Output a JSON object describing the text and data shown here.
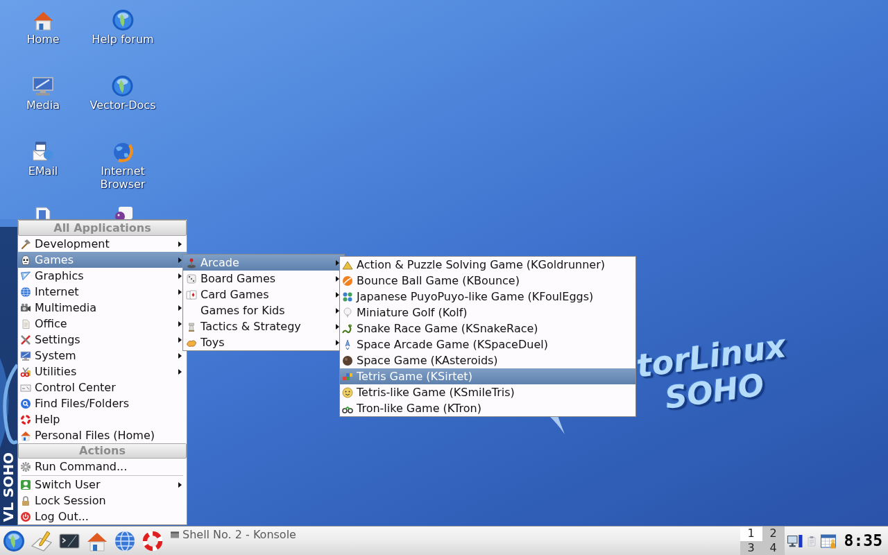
{
  "desktop": {
    "icons": [
      {
        "label": "Home"
      },
      {
        "label": "Help forum"
      },
      {
        "label": "Media"
      },
      {
        "label": "Vector-Docs"
      },
      {
        "label": "EMail"
      },
      {
        "label": "Internet Browser"
      }
    ],
    "wallpaper_logo": [
      "torLinux",
      "SOHO"
    ]
  },
  "start_menu": {
    "side_label": "VL SOHO",
    "sections": [
      {
        "title": "All Applications",
        "items": [
          {
            "label": "Development",
            "submenu": true,
            "selected": false
          },
          {
            "label": "Games",
            "submenu": true,
            "selected": true
          },
          {
            "label": "Graphics",
            "submenu": true,
            "selected": false
          },
          {
            "label": "Internet",
            "submenu": true,
            "selected": false
          },
          {
            "label": "Multimedia",
            "submenu": true,
            "selected": false
          },
          {
            "label": "Office",
            "submenu": true,
            "selected": false
          },
          {
            "label": "Settings",
            "submenu": true,
            "selected": false
          },
          {
            "label": "System",
            "submenu": true,
            "selected": false
          },
          {
            "label": "Utilities",
            "submenu": true,
            "selected": false
          },
          {
            "label": "Control Center",
            "submenu": false,
            "selected": false
          },
          {
            "label": "Find Files/Folders",
            "submenu": false,
            "selected": false
          },
          {
            "label": "Help",
            "submenu": false,
            "selected": false
          },
          {
            "label": "Personal Files (Home)",
            "submenu": false,
            "selected": false
          }
        ]
      },
      {
        "title": "Actions",
        "items": [
          {
            "label": "Run Command...",
            "submenu": false,
            "selected": false
          },
          {
            "label": "Switch User",
            "submenu": true,
            "selected": false,
            "separator_before": true
          },
          {
            "label": "Lock Session",
            "submenu": false,
            "selected": false
          },
          {
            "label": "Log Out...",
            "submenu": false,
            "selected": false
          }
        ]
      }
    ]
  },
  "games_menu": {
    "items": [
      {
        "label": "Arcade",
        "submenu": true,
        "selected": true
      },
      {
        "label": "Board Games",
        "submenu": true,
        "selected": false
      },
      {
        "label": "Card Games",
        "submenu": true,
        "selected": false
      },
      {
        "label": "Games for Kids",
        "submenu": true,
        "selected": false
      },
      {
        "label": "Tactics & Strategy",
        "submenu": true,
        "selected": false
      },
      {
        "label": "Toys",
        "submenu": true,
        "selected": false
      }
    ]
  },
  "arcade_menu": {
    "items": [
      {
        "label": "Action & Puzzle Solving Game (KGoldrunner)",
        "submenu": false,
        "selected": false
      },
      {
        "label": "Bounce Ball Game (KBounce)",
        "submenu": false,
        "selected": false
      },
      {
        "label": "Japanese PuyoPuyo-like Game (KFoulEggs)",
        "submenu": false,
        "selected": false
      },
      {
        "label": "Miniature Golf (Kolf)",
        "submenu": false,
        "selected": false
      },
      {
        "label": "Snake Race Game (KSnakeRace)",
        "submenu": false,
        "selected": false
      },
      {
        "label": "Space Arcade Game (KSpaceDuel)",
        "submenu": false,
        "selected": false
      },
      {
        "label": "Space Game (KAsteroids)",
        "submenu": false,
        "selected": false
      },
      {
        "label": "Tetris Game (KSirtet)",
        "submenu": false,
        "selected": true
      },
      {
        "label": "Tetris-like Game (KSmileTris)",
        "submenu": false,
        "selected": false
      },
      {
        "label": "Tron-like Game (KTron)",
        "submenu": false,
        "selected": false
      }
    ]
  },
  "taskbar": {
    "task": {
      "label": "Shell No. 2 - Konsole"
    },
    "pager": [
      {
        "label": "1",
        "selected": true
      },
      {
        "label": "2",
        "selected": false
      },
      {
        "label": "3",
        "selected": false
      },
      {
        "label": "4",
        "selected": false
      }
    ],
    "clock": "8:35"
  }
}
